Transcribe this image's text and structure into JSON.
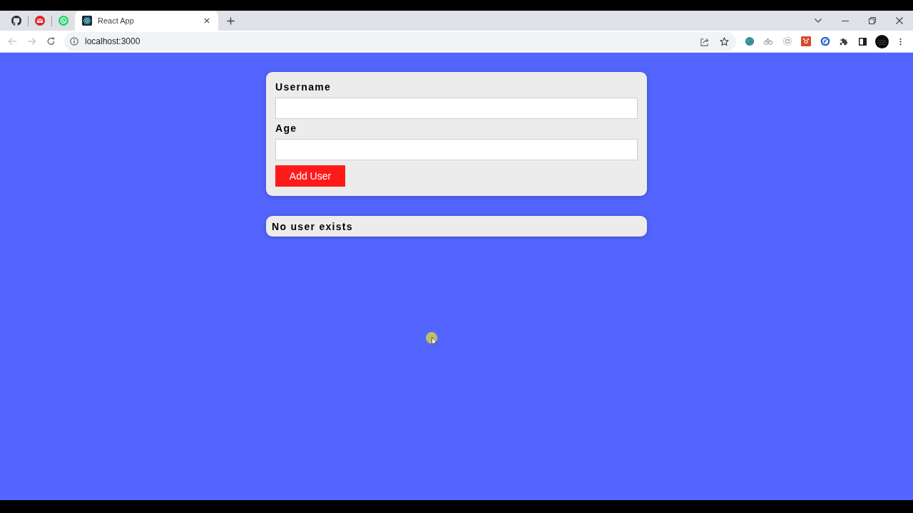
{
  "browser": {
    "tabs": [
      {
        "kind": "pinned",
        "selected": false
      },
      {
        "kind": "pinned",
        "selected": false
      },
      {
        "kind": "pinned",
        "selected": false
      },
      {
        "kind": "page",
        "title": "React App",
        "selected": true
      }
    ],
    "back": {
      "disabled": true
    },
    "forward": {
      "disabled": true
    },
    "address": "localhost:3000"
  },
  "form": {
    "fields": [
      {
        "label": "Username"
      },
      {
        "label": "Age"
      }
    ],
    "button": "Add User"
  },
  "user_list": {
    "message": "No user exists"
  }
}
